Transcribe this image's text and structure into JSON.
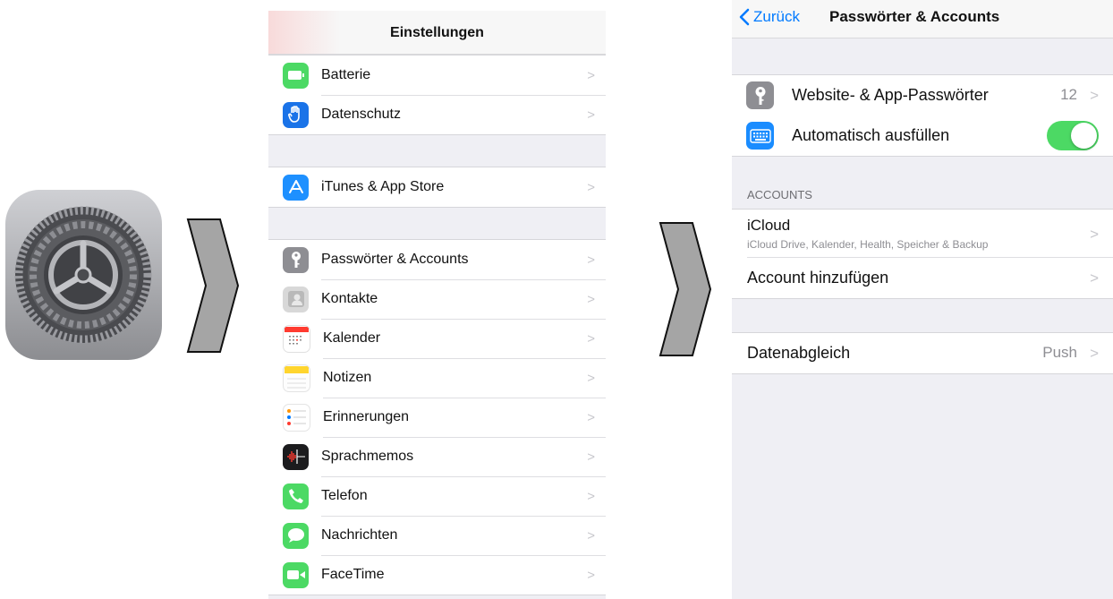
{
  "settings": {
    "title": "Einstellungen",
    "groups": [
      [
        {
          "label": "Batterie",
          "icon": "battery-icon",
          "color": "#4cd964"
        },
        {
          "label": "Datenschutz",
          "icon": "hand-icon",
          "color": "#1a73e8"
        }
      ],
      [
        {
          "label": "iTunes & App Store",
          "icon": "app-store-icon",
          "color": "#1e90ff"
        }
      ],
      [
        {
          "label": "Passwörter & Accounts",
          "icon": "key-icon",
          "color": "#8e8e93"
        },
        {
          "label": "Kontakte",
          "icon": "contacts-icon",
          "color": "#c9c9c9"
        },
        {
          "label": "Kalender",
          "icon": "calendar-icon",
          "color": "#ffffff"
        },
        {
          "label": "Notizen",
          "icon": "notes-icon",
          "color": "#ffd52e"
        },
        {
          "label": "Erinnerungen",
          "icon": "reminders-icon",
          "color": "#ffffff"
        },
        {
          "label": "Sprachmemos",
          "icon": "voice-memo-icon",
          "color": "#1c1c1e"
        },
        {
          "label": "Telefon",
          "icon": "phone-icon",
          "color": "#4cd964"
        },
        {
          "label": "Nachrichten",
          "icon": "messages-icon",
          "color": "#4cd964"
        },
        {
          "label": "FaceTime",
          "icon": "facetime-icon",
          "color": "#4cd964"
        }
      ]
    ]
  },
  "accounts": {
    "back_label": "Zurück",
    "title": "Passwörter & Accounts",
    "passwords_label": "Website- & App-Passwörter",
    "passwords_count": "12",
    "autofill_label": "Automatisch ausfüllen",
    "autofill_on": true,
    "section_header": "ACCOUNTS",
    "icloud_title": "iCloud",
    "icloud_subtitle": "iCloud Drive, Kalender, Health, Speicher & Backup",
    "add_account_label": "Account hinzufügen",
    "fetch_label": "Datenabgleich",
    "fetch_value": "Push"
  },
  "colors": {
    "accent": "#007aff",
    "toggle_on": "#4cd964"
  }
}
